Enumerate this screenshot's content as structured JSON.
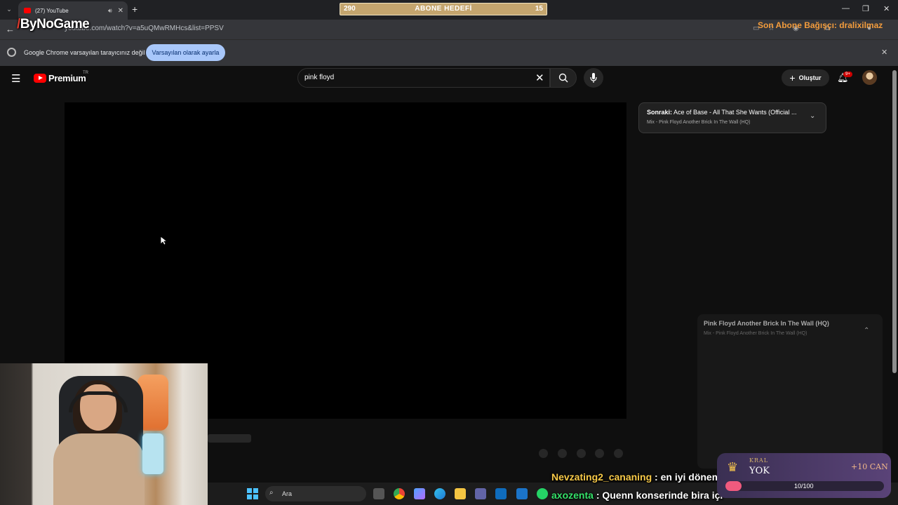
{
  "browser": {
    "tab_title": "(27) YouTube",
    "url": "youtube.com/watch?v=a5uQMwRMHcs&list=PPSV",
    "infobar_text": "Google Chrome varsayılan tarayıcınız değil",
    "infobar_button": "Varsayılan olarak ayarla"
  },
  "overlay": {
    "goal_left": "290",
    "goal_title": "ABONE HEDEFİ",
    "goal_right": "15",
    "logo_text": "ByNoGame",
    "top_donor": "Son Abone Bağışçı: dralixilmaz"
  },
  "youtube": {
    "logo_text": "Premium",
    "country": "TR",
    "search_value": "pink floyd",
    "create_label": "Oluştur",
    "notif_badge": "9+",
    "upnext_label": "Sonraki:",
    "upnext_title": "Ace of Base - All That She Wants (Official ...",
    "upnext_sub": "Mix - Pink Floyd Another Brick In The Wall (HQ)",
    "mix_title": "Pink Floyd Another Brick In The Wall (HQ)",
    "mix_sub": "Mix - Pink Floyd Another Brick In The Wall (HQ)"
  },
  "taskbar": {
    "search_label": "Ara"
  },
  "chat": [
    {
      "user": "Nevzating2_cananing",
      "msg": ": en iyi döneml"
    },
    {
      "user": "axozenta",
      "msg": ": Quenn konserinde bira içi"
    }
  ],
  "king": {
    "label": "KRAL",
    "name": "YOK",
    "reward": "+10 CAN",
    "progress_text": "10/100",
    "progress_fraction": 0.1
  },
  "colors": {
    "yt_red": "#ff0000",
    "goal_bar": "#c4a56e",
    "chrome_button": "#a8c7fa"
  }
}
